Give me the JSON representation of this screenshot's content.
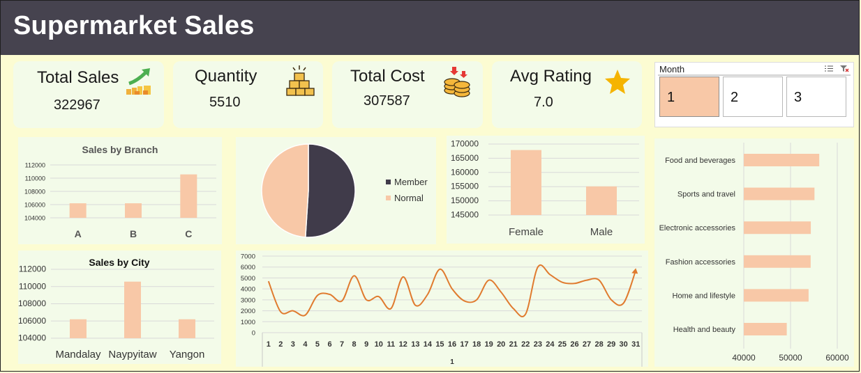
{
  "app": {
    "title": "Supermarket Sales"
  },
  "kpis": {
    "total_sales": {
      "label": "Total Sales",
      "value": "322967",
      "icon": "rising-sales-icon"
    },
    "quantity": {
      "label": "Quantity",
      "value": "5510",
      "icon": "stacked-boxes-icon"
    },
    "total_cost": {
      "label": "Total Cost",
      "value": "307587",
      "icon": "coins-icon"
    },
    "avg_rating": {
      "label": "Avg Rating",
      "value": "7.0",
      "icon": "star-icon"
    }
  },
  "slicer": {
    "title": "Month",
    "items": [
      "1",
      "2",
      "3"
    ],
    "selected": "1"
  },
  "colors": {
    "bar": "#f8c8a7",
    "dark": "#403b4a",
    "line": "#e07b2f",
    "header": "#46434f",
    "page": "#fcfcd2",
    "panel": "#f3fbe9"
  },
  "chart_data": [
    {
      "id": "branch",
      "type": "bar",
      "title": "Sales by Branch",
      "categories": [
        "A",
        "B",
        "C"
      ],
      "values": [
        106200,
        106200,
        110568
      ],
      "ylim": [
        104000,
        112000
      ],
      "yticks": [
        "112000",
        "110000",
        "108000",
        "106000",
        "104000"
      ]
    },
    {
      "id": "city",
      "type": "bar",
      "title": "Sales by City",
      "categories": [
        "Mandalay",
        "Naypyitaw",
        "Yangon"
      ],
      "values": [
        106200,
        110568,
        106200
      ],
      "ylim": [
        104000,
        112000
      ],
      "yticks": [
        "112000",
        "110000",
        "108000",
        "106000",
        "104000"
      ]
    },
    {
      "id": "customer",
      "type": "pie",
      "labels": [
        "Member",
        "Normal"
      ],
      "values": [
        51,
        49
      ]
    },
    {
      "id": "gender",
      "type": "bar",
      "categories": [
        "Female",
        "Male"
      ],
      "values": [
        167883,
        155084
      ],
      "ylim": [
        145000,
        170000
      ],
      "yticks": [
        "170000",
        "165000",
        "160000",
        "155000",
        "150000",
        "145000"
      ]
    },
    {
      "id": "daily",
      "type": "line",
      "x": [
        "1",
        "2",
        "3",
        "4",
        "5",
        "6",
        "7",
        "8",
        "9",
        "10",
        "11",
        "12",
        "13",
        "14",
        "15",
        "16",
        "17",
        "18",
        "19",
        "20",
        "21",
        "22",
        "23",
        "24",
        "25",
        "26",
        "27",
        "28",
        "29",
        "30",
        "31"
      ],
      "values": [
        4700,
        1900,
        2000,
        1600,
        3400,
        3500,
        2900,
        5200,
        3000,
        3300,
        2200,
        5100,
        2500,
        3500,
        5800,
        4000,
        2900,
        3000,
        4800,
        3700,
        2200,
        1700,
        6000,
        5300,
        4600,
        4500,
        4800,
        4800,
        3000,
        2700,
        5700
      ],
      "ylim": [
        0,
        7000
      ],
      "yticks": [
        "7000",
        "6000",
        "5000",
        "4000",
        "3000",
        "2000",
        "1000",
        "0"
      ],
      "xlabel": "1"
    },
    {
      "id": "product",
      "type": "bar",
      "orientation": "horizontal",
      "categories": [
        "Food and beverages",
        "Sports and travel",
        "Electronic accessories",
        "Fashion accessories",
        "Home and lifestyle",
        "Health and beauty"
      ],
      "values": [
        56145,
        55123,
        54338,
        54306,
        53862,
        49194
      ],
      "xlim": [
        40000,
        60000
      ],
      "xticks": [
        "40000",
        "50000",
        "60000"
      ]
    }
  ]
}
